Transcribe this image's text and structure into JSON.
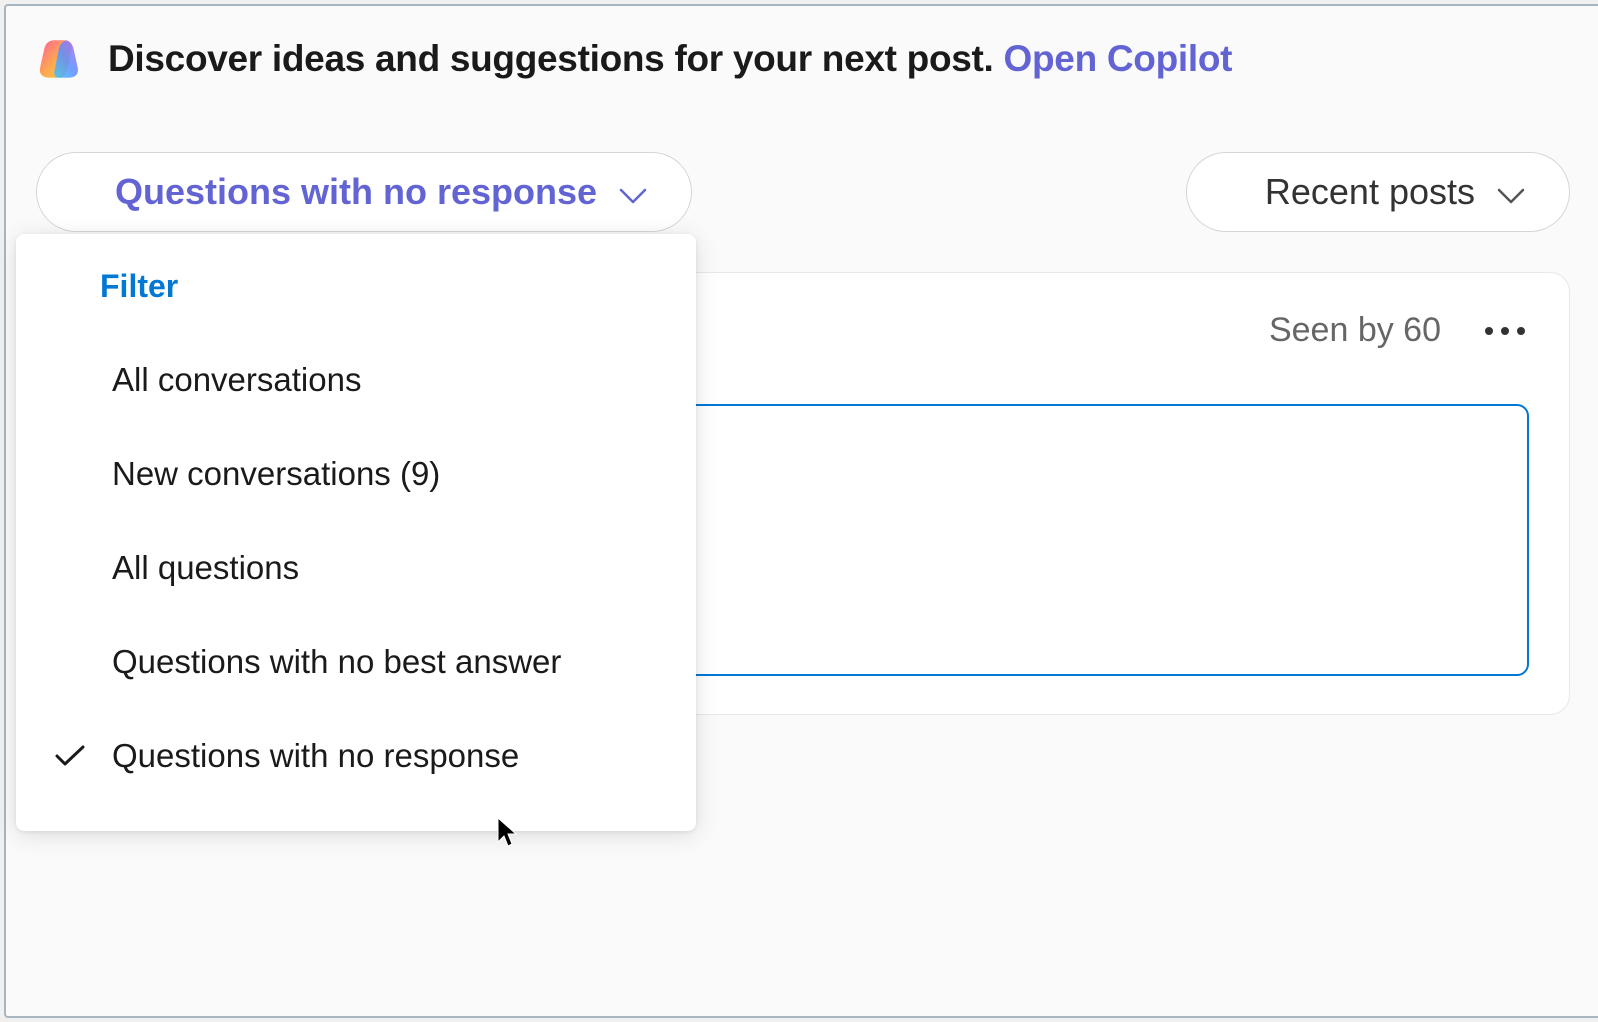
{
  "banner": {
    "text": "Discover ideas and suggestions for your next post. ",
    "link_text": "Open Copilot"
  },
  "filters": {
    "primary_selected": "Questions with no response",
    "secondary_selected": "Recent posts",
    "dropdown": {
      "header": "Filter",
      "items": [
        {
          "label": "All conversations",
          "checked": false
        },
        {
          "label": "New conversations (9)",
          "checked": false
        },
        {
          "label": "All questions",
          "checked": false
        },
        {
          "label": "Questions with no best answer",
          "checked": false
        },
        {
          "label": "Questions with no response",
          "checked": true
        }
      ]
    }
  },
  "post": {
    "seen_by": "Seen by 60"
  }
}
